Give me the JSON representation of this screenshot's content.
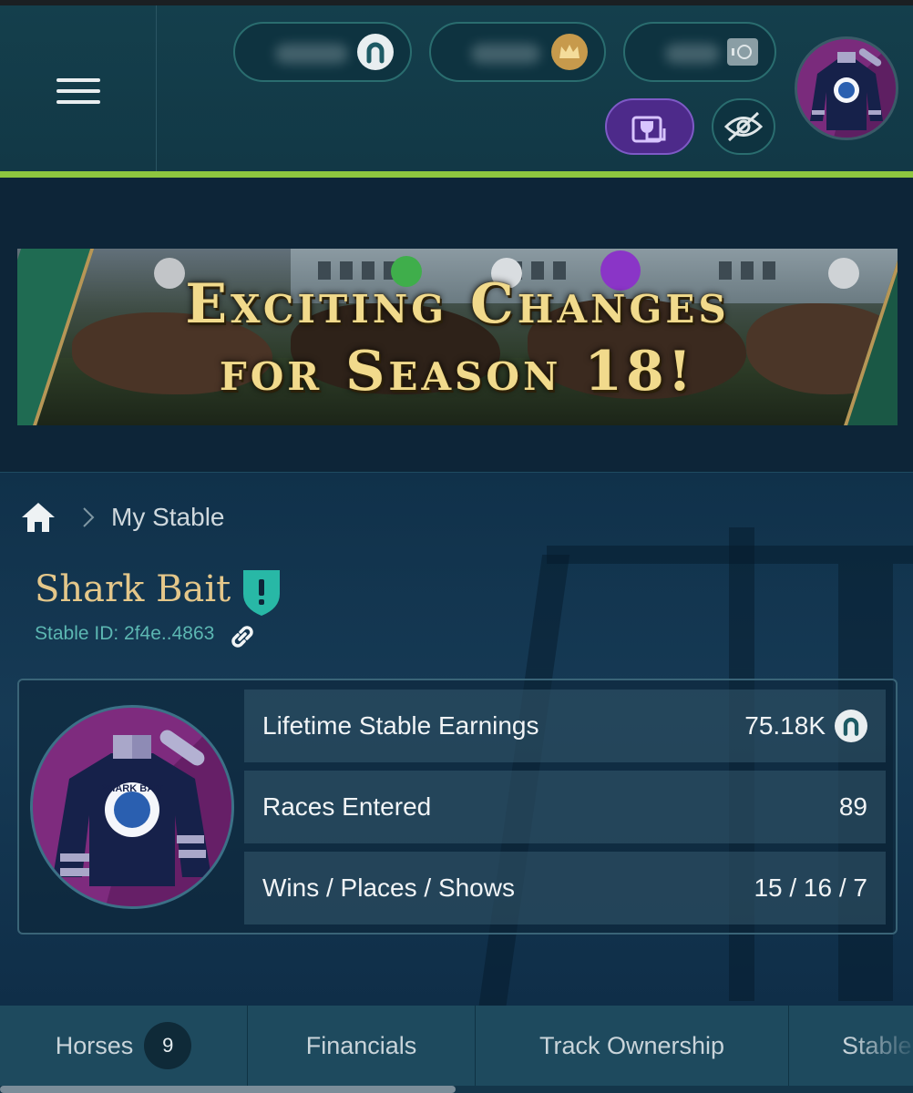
{
  "header": {
    "balances": [
      {
        "name": "horseshoe-balance",
        "icon": "horseshoe-icon",
        "value_hidden": true
      },
      {
        "name": "crown-balance",
        "icon": "crown-icon",
        "value_hidden": true
      },
      {
        "name": "vault-balance",
        "icon": "safe-icon",
        "value_hidden": true
      }
    ],
    "plug_button_icon": "plug-icon",
    "visibility_button_icon": "eye-off-icon",
    "accent_green": "#8dc63f"
  },
  "banner": {
    "line1": "Exciting Changes",
    "line2": "for Season 18!"
  },
  "breadcrumb": {
    "home_icon": "home-icon",
    "current": "My Stable"
  },
  "stable": {
    "name": "Shark Bait",
    "status_icon": "alert-shield-icon",
    "id_label": "Stable ID: 2f4e..4863",
    "copy_icon": "link-icon",
    "avatar_text": "SHARK BAIT"
  },
  "stats": [
    {
      "label": "Lifetime Stable Earnings",
      "value": "75.18K",
      "icon": "horseshoe-icon"
    },
    {
      "label": "Races Entered",
      "value": "89"
    },
    {
      "label": "Wins / Places / Shows",
      "value": "15 / 16 / 7"
    }
  ],
  "tabs": [
    {
      "label": "Horses",
      "badge": "9"
    },
    {
      "label": "Financials"
    },
    {
      "label": "Track Ownership"
    },
    {
      "label": "Stable"
    }
  ]
}
